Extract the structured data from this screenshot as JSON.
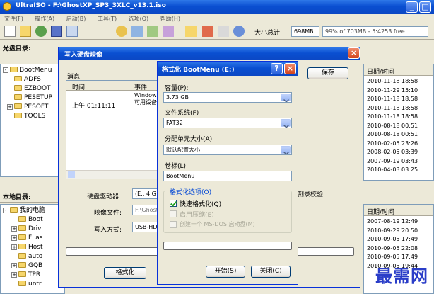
{
  "main_window": {
    "title": "UltraISO - F:\\GhostXP_SP3_3XLC_v13.1.iso",
    "menu": [
      "文件(F)",
      "操作(A)",
      "启动(B)",
      "工具(T)",
      "选项(O)",
      "帮助(H)"
    ],
    "size_label": "大小总计:",
    "size_value": "698MB",
    "size_percent": "99% of 703MB - 5:4253 free"
  },
  "left_panel": {
    "header": "光盘目录:",
    "tree": [
      "BootMenu",
      "ADFS",
      "EZBOOT",
      "PESETUP",
      "PESOFT",
      "TOOLS"
    ]
  },
  "local_panel": {
    "header": "本地目录:",
    "tree": [
      "我的电脑",
      "Boot",
      "Driv",
      "FLas",
      "Host",
      "auto",
      "GQB",
      "TPR",
      "untr"
    ]
  },
  "right_upper": {
    "header": "日期/时间",
    "dates": [
      "2010-11-18 18:58",
      "2010-11-29 15:10",
      "2010-11-18 18:58",
      "2010-11-18 18:58",
      "2010-11-18 18:58",
      "2010-08-18 00:51",
      "2010-08-18 00:51",
      "2010-02-05 23:26",
      "2008-02-05 03:39",
      "2007-09-19 03:43",
      "2010-04-03 03:25"
    ]
  },
  "right_lower": {
    "header": "日期/时间",
    "dates": [
      "2007-08-19 12:49",
      "2010-09-29 20:50",
      "2010-09-05 17:49",
      "2010-09-05 22:08",
      "2010-09-05 17:49",
      "2010-09-05 19:44"
    ]
  },
  "write_dialog": {
    "title": "写入硬盘映像",
    "message_label": "消息:",
    "col_time": "时间",
    "col_event": "事件",
    "row_time": "上午 01:11:11",
    "row_event": "Windows\n可用设备",
    "save_button": "保存",
    "drive_label": "硬盘驱动器",
    "drive_value": "(E:, 4 G",
    "image_label": "映像文件:",
    "image_value": "F:\\GhostX",
    "method_label": "写入方式:",
    "method_value": "USB-HDD+",
    "format_button": "格式化",
    "verify_label": "刻录校验"
  },
  "format_dialog": {
    "title": "格式化 BootMenu (E:)",
    "capacity_label": "容量(P):",
    "capacity_value": "3.73 GB",
    "fs_label": "文件系统(F)",
    "fs_value": "FAT32",
    "alloc_label": "分配单元大小(A)",
    "alloc_value": "默认配置大小",
    "volume_label": "卷标(L)",
    "volume_value": "BootMenu",
    "options_label": "格式化选项(O)",
    "quick_format": "快速格式化(Q)",
    "compress": "启用压缩(E)",
    "msdos": "创建一个 MS-DOS 启动盘(M)",
    "start_button": "开始(S)",
    "close_button": "关闭(C)"
  },
  "watermark": "最需网"
}
